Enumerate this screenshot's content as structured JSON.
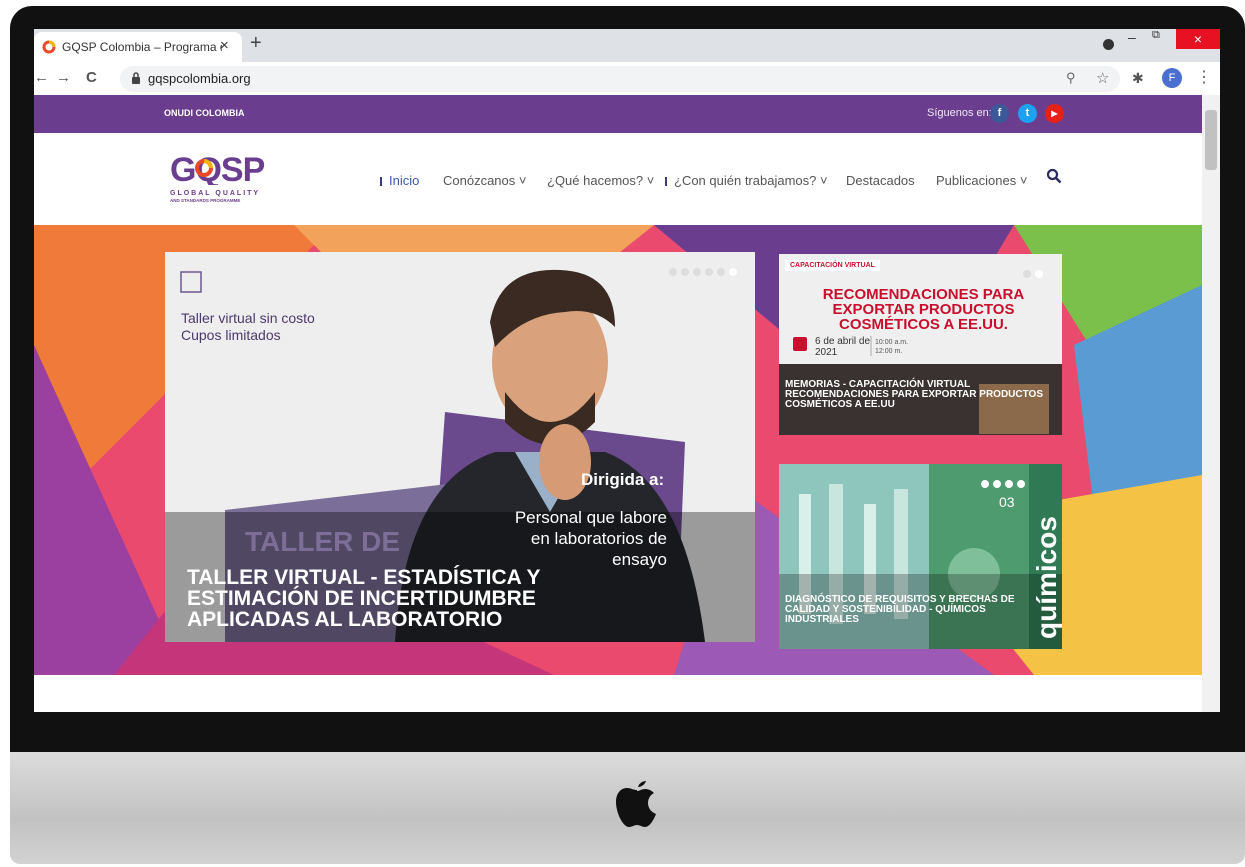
{
  "browser": {
    "tab_title": "GQSP Colombia – Programa de C",
    "tab_close": "×",
    "new_tab": "+",
    "url": "gqspcolombia.org",
    "back": "←",
    "forward": "→",
    "reload": "C",
    "profile_initial": "F",
    "minimize": "–",
    "restore": "⧉",
    "close": "×"
  },
  "topbar": {
    "brand": "ONUDI COLOMBIA",
    "follow_label": "Síguenos en:",
    "social": [
      "f",
      "t",
      "▶"
    ]
  },
  "logo": {
    "name": "GQSP",
    "tagline": "GLOBAL QUALITY",
    "tagline2": "AND STANDARDS PROGRAMME"
  },
  "menu": [
    {
      "label": "Inicio"
    },
    {
      "label": "Conózcanos ˅"
    },
    {
      "label": "¿Qué hacemos? ˅"
    },
    {
      "label": "¿Con quién trabajamos? ˅"
    },
    {
      "label": "Destacados"
    },
    {
      "label": "Publicaciones ˅"
    }
  ],
  "hero": {
    "slide": {
      "tag1": "Taller virtual sin costo",
      "tag2": "Cupos limitados",
      "dirigida": "Dirigida a:",
      "personal": "Personal que labore en laboratorios de ensayo",
      "taller_de": "TALLER DE",
      "title": "TALLER VIRTUAL - ESTADÍSTICA Y ESTIMACIÓN DE INCERTIDUMBRE APLICADAS AL LABORATORIO"
    },
    "card1": {
      "tag": "CAPACITACIÓN VIRTUAL",
      "headline": "RECOMENDACIONES PARA EXPORTAR PRODUCTOS COSMÉTICOS A EE.UU.",
      "date": "6 de abril de 2021",
      "time": "10:00 a.m. 12:00 m.",
      "title": "MEMORIAS - CAPACITACIÓN VIRTUAL RECOMENDACIONES PARA EXPORTAR PRODUCTOS COSMÉTICOS A EE.UU"
    },
    "card2": {
      "number": "03",
      "word": "químicos",
      "title": "DIAGNÓSTICO DE REQUISITOS Y BRECHAS DE CALIDAD Y SOSTENIBILIDAD - QUÍMICOS INDUSTRIALES"
    }
  },
  "colors": {
    "topbar": "#6b3d8e",
    "accent_red": "#c8102e",
    "nav_active": "#3b5aa8"
  }
}
